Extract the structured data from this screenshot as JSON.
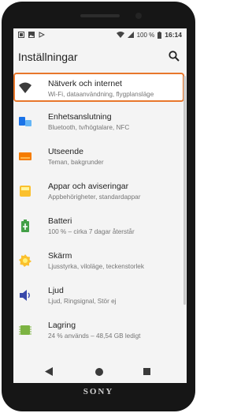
{
  "device": {
    "brand": "SONY"
  },
  "statusbar": {
    "battery_pct": "100 %",
    "time": "16:14"
  },
  "appbar": {
    "title": "Inställningar"
  },
  "settings": [
    {
      "label": "Nätverk och internet",
      "sub": "Wi-Fi, dataanvändning, flygplansläge",
      "icon": "wifi-icon",
      "color": "#1a73e8"
    },
    {
      "label": "Enhetsanslutning",
      "sub": "Bluetooth, tv/högtalare, NFC",
      "icon": "devices-icon",
      "color": "#1a73e8"
    },
    {
      "label": "Utseende",
      "sub": "Teman, bakgrunder",
      "icon": "display-icon",
      "color": "#f57c00"
    },
    {
      "label": "Appar och aviseringar",
      "sub": "Appbehörigheter, standardappar",
      "icon": "apps-icon",
      "color": "#f9a825"
    },
    {
      "label": "Batteri",
      "sub": "100 % – cirka 7 dagar återstår",
      "icon": "battery-icon",
      "color": "#43a047"
    },
    {
      "label": "Skärm",
      "sub": "Ljusstyrka, viloläge, teckenstorlek",
      "icon": "brightness-icon",
      "color": "#f9a825"
    },
    {
      "label": "Ljud",
      "sub": "Ljud, Ringsignal, Stör ej",
      "icon": "volume-icon",
      "color": "#3949ab"
    },
    {
      "label": "Lagring",
      "sub": "24 % används – 48,54 GB ledigt",
      "icon": "storage-icon",
      "color": "#7cb342"
    }
  ],
  "accent": "#e8772c"
}
